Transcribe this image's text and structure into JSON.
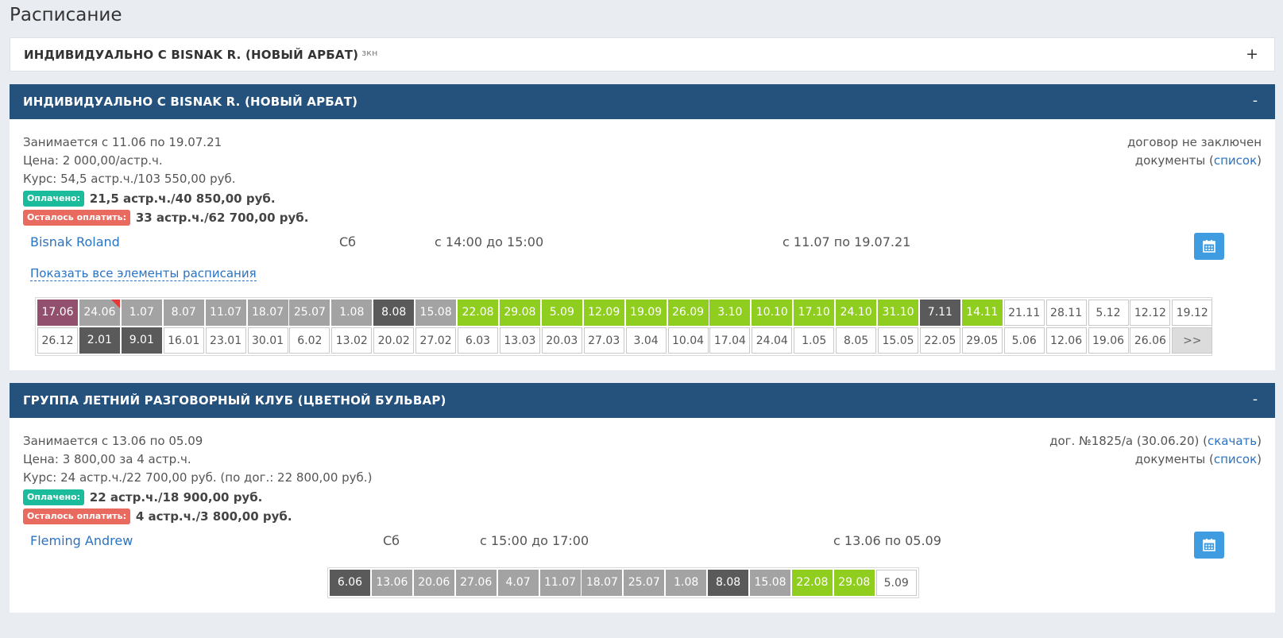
{
  "page_title": "Расписание",
  "icons": {
    "calendar": "calendar-icon"
  },
  "colors": {
    "header": "#24527d",
    "paid_badge": "#1abc9c",
    "left_badge": "#e96a5f",
    "lesson_paid": "#8fce1f",
    "lesson_past": "#a3a3a3",
    "lesson_missed": "#5a5a5a",
    "lesson_cancelled": "#93506e",
    "link": "#2a73c3"
  },
  "collapsed_course": {
    "title": "ИНДИВИДУАЛЬНО С BISNAK R. (НОВЫЙ АРБАТ)",
    "tag": "зкн",
    "toggle": "+"
  },
  "course1": {
    "title": "ИНДИВИДУАЛЬНО С BISNAK R. (НОВЫЙ АРБАТ)",
    "toggle": "-",
    "period": "Занимается с 11.06 по 19.07.21",
    "price": "Цена: 2 000,00/астр.ч.",
    "course": "Курс: 54,5 астр.ч./103 550,00 руб.",
    "paid_label": "Оплачено:",
    "paid_value": "21,5 астр.ч./40 850,00 руб.",
    "left_label": "Осталось оплатить:",
    "left_value": "33 астр.ч./62 700,00 руб.",
    "contract": "договор не заключен",
    "docs_prefix": "документы (",
    "docs_link": "список",
    "docs_suffix": ")",
    "teacher": "Bisnak Roland",
    "weekday": "Сб",
    "time": "с 14:00 до 15:00",
    "range": "с 11.07 по 19.07.21",
    "show_all": "Показать все элементы расписания",
    "lessons_row1": [
      {
        "d": "17.06",
        "s": "cancel"
      },
      {
        "d": "24.06",
        "s": "past",
        "flag": true
      },
      {
        "d": "1.07",
        "s": "past"
      },
      {
        "d": "8.07",
        "s": "past"
      },
      {
        "d": "11.07",
        "s": "past"
      },
      {
        "d": "18.07",
        "s": "past"
      },
      {
        "d": "25.07",
        "s": "past"
      },
      {
        "d": "1.08",
        "s": "past"
      },
      {
        "d": "8.08",
        "s": "missed"
      },
      {
        "d": "15.08",
        "s": "past"
      },
      {
        "d": "22.08",
        "s": "paid"
      },
      {
        "d": "29.08",
        "s": "paid"
      },
      {
        "d": "5.09",
        "s": "paid"
      },
      {
        "d": "12.09",
        "s": "paid"
      },
      {
        "d": "19.09",
        "s": "paid"
      },
      {
        "d": "26.09",
        "s": "paid"
      },
      {
        "d": "3.10",
        "s": "paid"
      },
      {
        "d": "10.10",
        "s": "paid"
      },
      {
        "d": "17.10",
        "s": "paid"
      },
      {
        "d": "24.10",
        "s": "paid"
      },
      {
        "d": "31.10",
        "s": "paid"
      },
      {
        "d": "7.11",
        "s": "missed"
      },
      {
        "d": "14.11",
        "s": "paid"
      },
      {
        "d": "21.11",
        "s": "future"
      },
      {
        "d": "28.11",
        "s": "future"
      },
      {
        "d": "5.12",
        "s": "future"
      },
      {
        "d": "12.12",
        "s": "future"
      },
      {
        "d": "19.12",
        "s": "future"
      }
    ],
    "lessons_row2": [
      {
        "d": "26.12",
        "s": "future"
      },
      {
        "d": "2.01",
        "s": "missed"
      },
      {
        "d": "9.01",
        "s": "missed"
      },
      {
        "d": "16.01",
        "s": "future"
      },
      {
        "d": "23.01",
        "s": "future"
      },
      {
        "d": "30.01",
        "s": "future"
      },
      {
        "d": "6.02",
        "s": "future"
      },
      {
        "d": "13.02",
        "s": "future"
      },
      {
        "d": "20.02",
        "s": "future"
      },
      {
        "d": "27.02",
        "s": "future"
      },
      {
        "d": "6.03",
        "s": "future"
      },
      {
        "d": "13.03",
        "s": "future"
      },
      {
        "d": "20.03",
        "s": "future"
      },
      {
        "d": "27.03",
        "s": "future"
      },
      {
        "d": "3.04",
        "s": "future"
      },
      {
        "d": "10.04",
        "s": "future"
      },
      {
        "d": "17.04",
        "s": "future"
      },
      {
        "d": "24.04",
        "s": "future"
      },
      {
        "d": "1.05",
        "s": "future"
      },
      {
        "d": "8.05",
        "s": "future"
      },
      {
        "d": "15.05",
        "s": "future"
      },
      {
        "d": "22.05",
        "s": "future"
      },
      {
        "d": "29.05",
        "s": "future"
      },
      {
        "d": "5.06",
        "s": "future"
      },
      {
        "d": "12.06",
        "s": "future"
      },
      {
        "d": "19.06",
        "s": "future"
      },
      {
        "d": "26.06",
        "s": "future"
      },
      {
        "d": ">>",
        "s": "more"
      }
    ]
  },
  "course2": {
    "title": "ГРУППА ЛЕТНИЙ РАЗГОВОРНЫЙ КЛУБ (ЦВЕТНОЙ БУЛЬВАР)",
    "toggle": "-",
    "period": "Занимается с 13.06 по 05.09",
    "price": "Цена: 3 800,00 за 4 астр.ч.",
    "course": "Курс: 24 астр.ч./22 700,00 руб. (по дог.: 22 800,00 руб.)",
    "paid_label": "Оплачено:",
    "paid_value": "22 астр.ч./18 900,00 руб.",
    "left_label": "Осталось оплатить:",
    "left_value": "4 астр.ч./3 800,00 руб.",
    "contract_prefix": "дог. №1825/а (30.06.20) (",
    "contract_link": "скачать",
    "contract_suffix": ")",
    "docs_prefix": "документы (",
    "docs_link": "список",
    "docs_suffix": ")",
    "teacher": "Fleming Andrew",
    "weekday": "Сб",
    "time": "с 15:00 до 17:00",
    "range": "с 13.06 по 05.09",
    "lessons": [
      {
        "d": "6.06",
        "s": "missed"
      },
      {
        "d": "13.06",
        "s": "past"
      },
      {
        "d": "20.06",
        "s": "past"
      },
      {
        "d": "27.06",
        "s": "past"
      },
      {
        "d": "4.07",
        "s": "past"
      },
      {
        "d": "11.07",
        "s": "past"
      },
      {
        "d": "18.07",
        "s": "past"
      },
      {
        "d": "25.07",
        "s": "past"
      },
      {
        "d": "1.08",
        "s": "past"
      },
      {
        "d": "8.08",
        "s": "missed"
      },
      {
        "d": "15.08",
        "s": "past"
      },
      {
        "d": "22.08",
        "s": "paid"
      },
      {
        "d": "29.08",
        "s": "paid"
      },
      {
        "d": "5.09",
        "s": "future"
      }
    ]
  }
}
